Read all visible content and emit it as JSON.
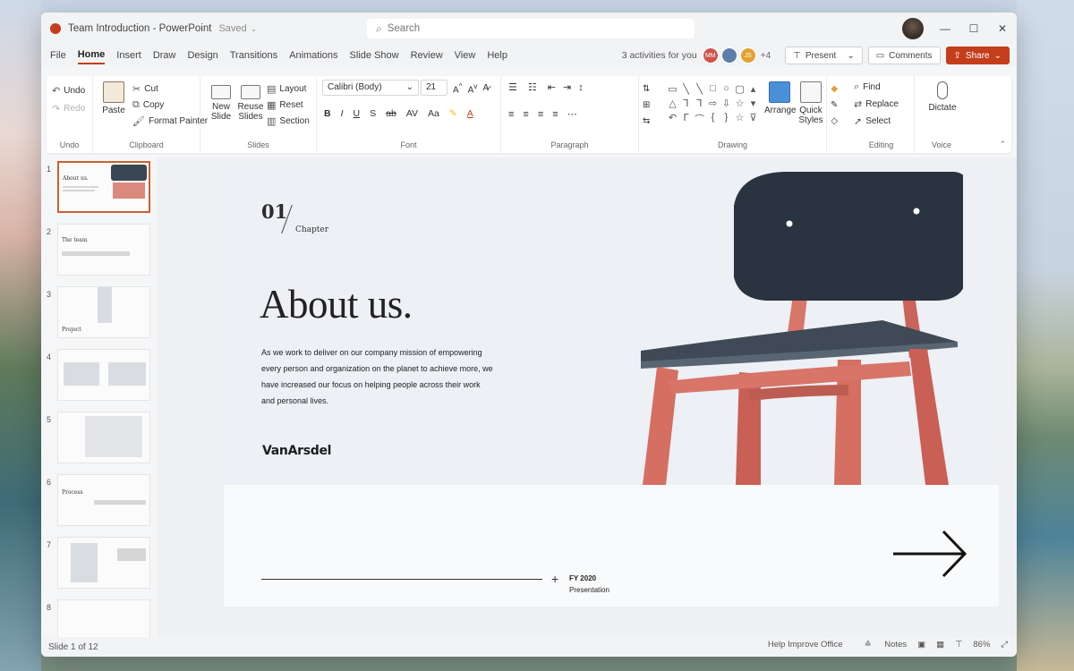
{
  "window": {
    "title": "Team Introduction - PowerPoint",
    "saved": "Saved",
    "search_placeholder": "Search"
  },
  "menu": {
    "tabs": [
      "File",
      "Home",
      "Insert",
      "Draw",
      "Design",
      "Transitions",
      "Animations",
      "Slide Show",
      "Review",
      "View",
      "Help"
    ],
    "activities": "3 activities for you",
    "avatars": [
      {
        "initials": "MM",
        "color": "#d0544a"
      },
      {
        "initials": "",
        "color": "#5b7fa8"
      },
      {
        "initials": "JS",
        "color": "#e3a12f"
      }
    ],
    "more_count": "+4",
    "present_label": "Present",
    "comments_label": "Comments",
    "share_label": "Share"
  },
  "ribbon": {
    "undo": {
      "undo": "Undo",
      "redo": "Redo",
      "label": "Undo"
    },
    "clipboard": {
      "paste": "Paste",
      "cut": "Cut",
      "copy": "Copy",
      "format_painter": "Format Painter",
      "label": "Clipboard"
    },
    "slides": {
      "new_slide_1": "New",
      "new_slide_2": "Slide",
      "reuse_1": "Reuse",
      "reuse_2": "Slides",
      "layout": "Layout",
      "reset": "Reset",
      "section": "Section",
      "label": "Slides"
    },
    "font": {
      "family": "Calibri (Body)",
      "size": "21",
      "label": "Font"
    },
    "paragraph": {
      "label": "Paragraph"
    },
    "drawing": {
      "arrange": "Arrange",
      "quick_1": "Quick",
      "quick_2": "Styles",
      "label": "Drawing"
    },
    "editing": {
      "find": "Find",
      "replace": "Replace",
      "select": "Select",
      "label": "Editing"
    },
    "voice": {
      "dictate": "Dictate",
      "label": "Voice"
    }
  },
  "thumbnails": [
    {
      "num": "1",
      "title": "About us.",
      "active": true
    },
    {
      "num": "2",
      "title": "The team",
      "active": false
    },
    {
      "num": "3",
      "title": "Project",
      "active": false
    },
    {
      "num": "4",
      "title": "",
      "active": false
    },
    {
      "num": "5",
      "title": "",
      "active": false
    },
    {
      "num": "6",
      "title": "Process",
      "active": false
    },
    {
      "num": "7",
      "title": "",
      "active": false
    },
    {
      "num": "8",
      "title": "",
      "active": false
    }
  ],
  "slide": {
    "chapter_num": "01",
    "chapter_label": "Chapter",
    "headline": "About us.",
    "body": "As we work to deliver on our company mission of empowering every person and organization on the planet to achieve more, we have increased our focus on helping people across their work and personal lives.",
    "brand": "VanArsdel",
    "footer_fy": "FY 2020",
    "footer_pres": "Presentation"
  },
  "status": {
    "slide_count": "Slide 1 of 12",
    "help": "Help Improve Office",
    "notes": "Notes",
    "zoom": "86%"
  }
}
